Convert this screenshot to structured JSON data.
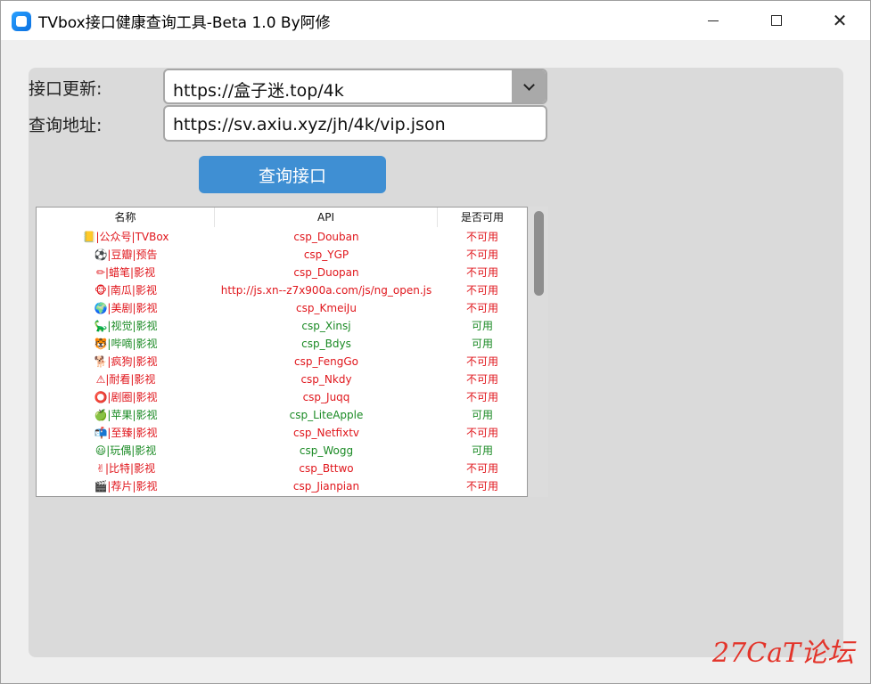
{
  "window": {
    "title": "TVbox接口健康查询工具-Beta 1.0 By阿修",
    "close_glyph": "✕"
  },
  "form": {
    "update_label": "接口更新:",
    "update_value": "https://盒子迷.top/4k",
    "query_label": "查询地址:",
    "query_value": "https://sv.axiu.xyz/jh/4k/vip.json",
    "query_button": "查询接口"
  },
  "table": {
    "columns": [
      "名称",
      "API",
      "是否可用"
    ],
    "rows": [
      {
        "icon": "📒",
        "name": "|公众号|TVBox",
        "api": "csp_Douban",
        "status": "不可用",
        "ok": false
      },
      {
        "icon": "⚽",
        "name": "|豆瓣|预告",
        "api": "csp_YGP",
        "status": "不可用",
        "ok": false
      },
      {
        "icon": "✏",
        "name": "|蜡笔|影视",
        "api": "csp_Duopan",
        "status": "不可用",
        "ok": false
      },
      {
        "icon": "🐵",
        "name": "|南瓜|影视",
        "api": "http://js.xn--z7x900a.com/js/ng_open.js",
        "status": "不可用",
        "ok": false
      },
      {
        "icon": "🌍",
        "name": "|美剧|影视",
        "api": "csp_KmeiJu",
        "status": "不可用",
        "ok": false
      },
      {
        "icon": "🦕",
        "name": "|视觉|影视",
        "api": "csp_Xinsj",
        "status": "可用",
        "ok": true
      },
      {
        "icon": "🐯",
        "name": "|哔嘀|影视",
        "api": "csp_Bdys",
        "status": "可用",
        "ok": true
      },
      {
        "icon": "🐕",
        "name": "|疯狗|影视",
        "api": "csp_FengGo",
        "status": "不可用",
        "ok": false
      },
      {
        "icon": "⚠",
        "name": "|耐看|影视",
        "api": "csp_Nkdy",
        "status": "不可用",
        "ok": false
      },
      {
        "icon": "⭕",
        "name": "|剧圈|影视",
        "api": "csp_Juqq",
        "status": "不可用",
        "ok": false
      },
      {
        "icon": "🍏",
        "name": "|苹果|影视",
        "api": "csp_LiteApple",
        "status": "可用",
        "ok": true
      },
      {
        "icon": "📬",
        "name": "|至臻|影视",
        "api": "csp_Netfixtv",
        "status": "不可用",
        "ok": false
      },
      {
        "icon": "😃",
        "name": "|玩偶|影视",
        "api": "csp_Wogg",
        "status": "可用",
        "ok": true
      },
      {
        "icon": "✌",
        "name": "|比特|影视",
        "api": "csp_Bttwo",
        "status": "不可用",
        "ok": false
      },
      {
        "icon": "🎬",
        "name": "|荐片|影视",
        "api": "csp_Jianpian",
        "status": "不可用",
        "ok": false
      }
    ]
  },
  "watermark": "27CaT论坛",
  "colors": {
    "accent": "#3f8fd3",
    "unavailable": "#e0161c",
    "available": "#1a8a24",
    "watermark": "#e3342a"
  }
}
